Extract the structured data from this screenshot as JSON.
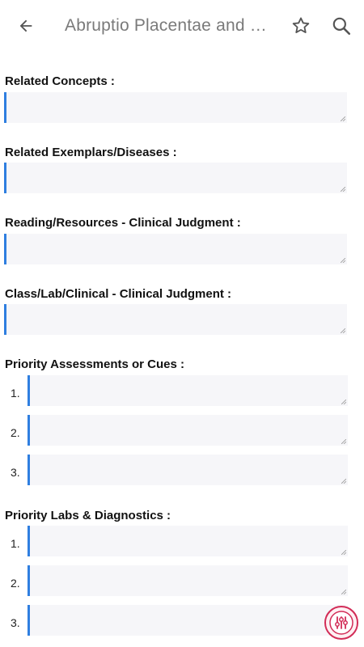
{
  "header": {
    "title": "Abruptio Placentae and Placenta Previa",
    "back_icon": "arrow-left-icon",
    "favorite_icon": "star-outline-icon",
    "search_icon": "search-icon"
  },
  "sections": {
    "related_concepts": {
      "label": "Related Concepts :"
    },
    "related_exemplars": {
      "label": "Related Exemplars/Diseases :"
    },
    "reading_resources": {
      "label": "Reading/Resources - Clinical Judgment :"
    },
    "class_lab_clinical": {
      "label": "Class/Lab/Clinical - Clinical Judgment :"
    },
    "priority_assessments": {
      "label": "Priority Assessments or Cues :",
      "items": [
        {
          "number": "1."
        },
        {
          "number": "2."
        },
        {
          "number": "3."
        }
      ]
    },
    "priority_labs": {
      "label": "Priority Labs & Diagnostics :",
      "items": [
        {
          "number": "1."
        },
        {
          "number": "2."
        },
        {
          "number": "3."
        }
      ]
    }
  },
  "fab": {
    "icon": "sliders-icon",
    "color": "#d22c57"
  },
  "colors": {
    "accent": "#2f7fe0",
    "field_bg": "#f6f6f9",
    "title_gray": "#7a7a7a"
  }
}
